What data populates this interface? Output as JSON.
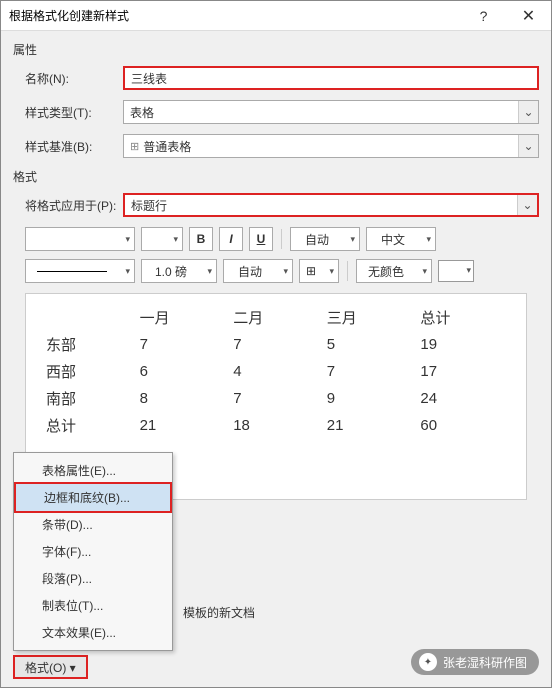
{
  "title": "根据格式化创建新样式",
  "help": "?",
  "close": "✕",
  "section_props": "属性",
  "label_name": "名称(N):",
  "name_value": "三线表",
  "label_type": "样式类型(T):",
  "type_value": "表格",
  "label_base": "样式基准(B):",
  "base_value": "普通表格",
  "section_format": "格式",
  "label_apply": "将格式应用于(P):",
  "apply_value": "标题行",
  "tb": {
    "bold": "B",
    "italic": "I",
    "underline": "U",
    "auto": "自动",
    "lang": "中文",
    "weight": "1.0 磅",
    "auto2": "自动",
    "nocolor": "无颜色"
  },
  "chart_data": {
    "type": "table",
    "columns": [
      "",
      "一月",
      "二月",
      "三月",
      "总计"
    ],
    "rows": [
      [
        "东部",
        7,
        7,
        5,
        19
      ],
      [
        "西部",
        6,
        4,
        7,
        17
      ],
      [
        "南部",
        8,
        7,
        9,
        24
      ],
      [
        "总计",
        21,
        18,
        21,
        60
      ]
    ]
  },
  "menu": {
    "table_props": "表格属性(E)...",
    "border_shading": "边框和底纹(B)...",
    "banding": "条带(D)...",
    "font": "字体(F)...",
    "paragraph": "段落(P)...",
    "tabs": "制表位(T)...",
    "text_effects": "文本效果(E)..."
  },
  "footer_template_text": "模板的新文档",
  "format_btn": "格式(O) ▾",
  "watermark": "张老湿科研作图"
}
